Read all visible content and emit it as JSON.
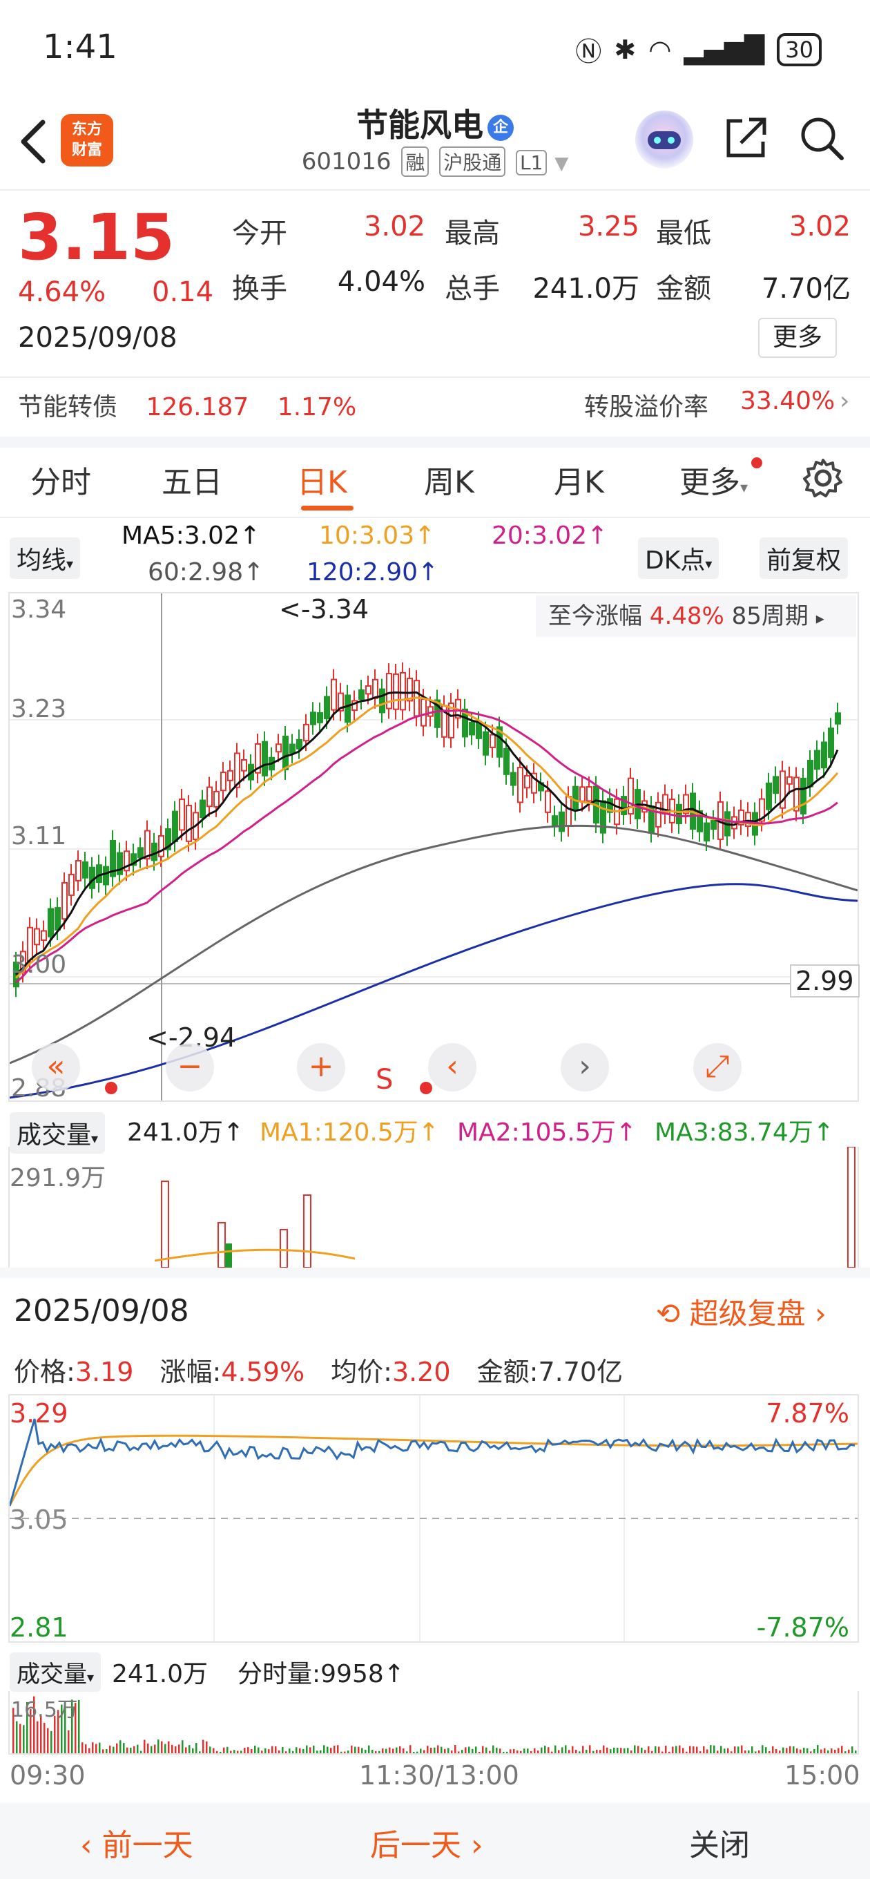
{
  "status_bar": {
    "time": "1:41",
    "battery": "30"
  },
  "header": {
    "name": "节能风电",
    "badge": "企",
    "code": "601016",
    "tags": [
      "融",
      "沪股通",
      "L1"
    ],
    "logo_line1": "东方",
    "logo_line2": "财富"
  },
  "quote": {
    "price": "3.15",
    "change_pct": "4.64%",
    "change_amt": "0.14",
    "date": "2025/09/08",
    "open_label": "今开",
    "open": "3.02",
    "high_label": "最高",
    "high": "3.25",
    "low_label": "最低",
    "low": "3.02",
    "turnover_label": "换手",
    "turnover": "4.04%",
    "volume_label": "总手",
    "volume": "241.0万",
    "amount_label": "金额",
    "amount": "7.70亿",
    "more": "更多"
  },
  "bond": {
    "name": "节能转债",
    "price": "126.187",
    "pct": "1.17%",
    "premium_label": "转股溢价率",
    "premium": "33.40%"
  },
  "tabs": [
    "分时",
    "五日",
    "日K",
    "周K",
    "月K",
    "更多"
  ],
  "ma": {
    "selector": "均线",
    "ma5": "MA5:3.02↑",
    "ma10": "10:3.03↑",
    "ma20": "20:3.02↑",
    "ma60": "60:2.98↑",
    "ma120": "120:2.90↑",
    "dk": "DK点",
    "adjust": "前复权"
  },
  "kline": {
    "yticks": [
      "3.34",
      "3.23",
      "3.11",
      "3.00",
      "2.88"
    ],
    "high_mark": "<-3.34",
    "low_mark": "<-2.94",
    "last_label": "2.99",
    "since_label": "至今涨幅",
    "since_pct": "4.48%",
    "periods": "85周期",
    "s_marker": "S"
  },
  "volume": {
    "selector": "成交量",
    "value": "241.0万↑",
    "ma1": "MA1:120.5万↑",
    "ma2": "MA2:105.5万↑",
    "ma3": "MA3:83.74万↑",
    "max": "291.9万"
  },
  "replay": {
    "date": "2025/09/08",
    "super_label": "超级复盘",
    "price_label": "价格:",
    "price": "3.19",
    "pct_label": "涨幅:",
    "pct": "4.59%",
    "avg_label": "均价:",
    "avg": "3.20",
    "amount_label": "金额:",
    "amount": "7.70亿",
    "y_top": "3.29",
    "y_mid": "3.05",
    "y_bot": "2.81",
    "pct_top": "7.87%",
    "pct_bot": "-7.87%",
    "vol_selector": "成交量",
    "vol_value": "241.0万",
    "tick_vol": "分时量:9958↑",
    "vol_max": "16.5万",
    "time_start": "09:30",
    "time_mid": "11:30/13:00",
    "time_end": "15:00"
  },
  "bottom": {
    "prev": "前一天",
    "next": "后一天",
    "close": "关闭"
  },
  "watermark": "东方财富",
  "colors": {
    "up": "#e5312d",
    "down": "#1f9a2a",
    "accent": "#f05a1a",
    "ma5": "#111111",
    "ma10": "#f0a020",
    "ma20": "#d0208a",
    "ma60": "#666666",
    "ma120": "#1b2fa8"
  }
}
